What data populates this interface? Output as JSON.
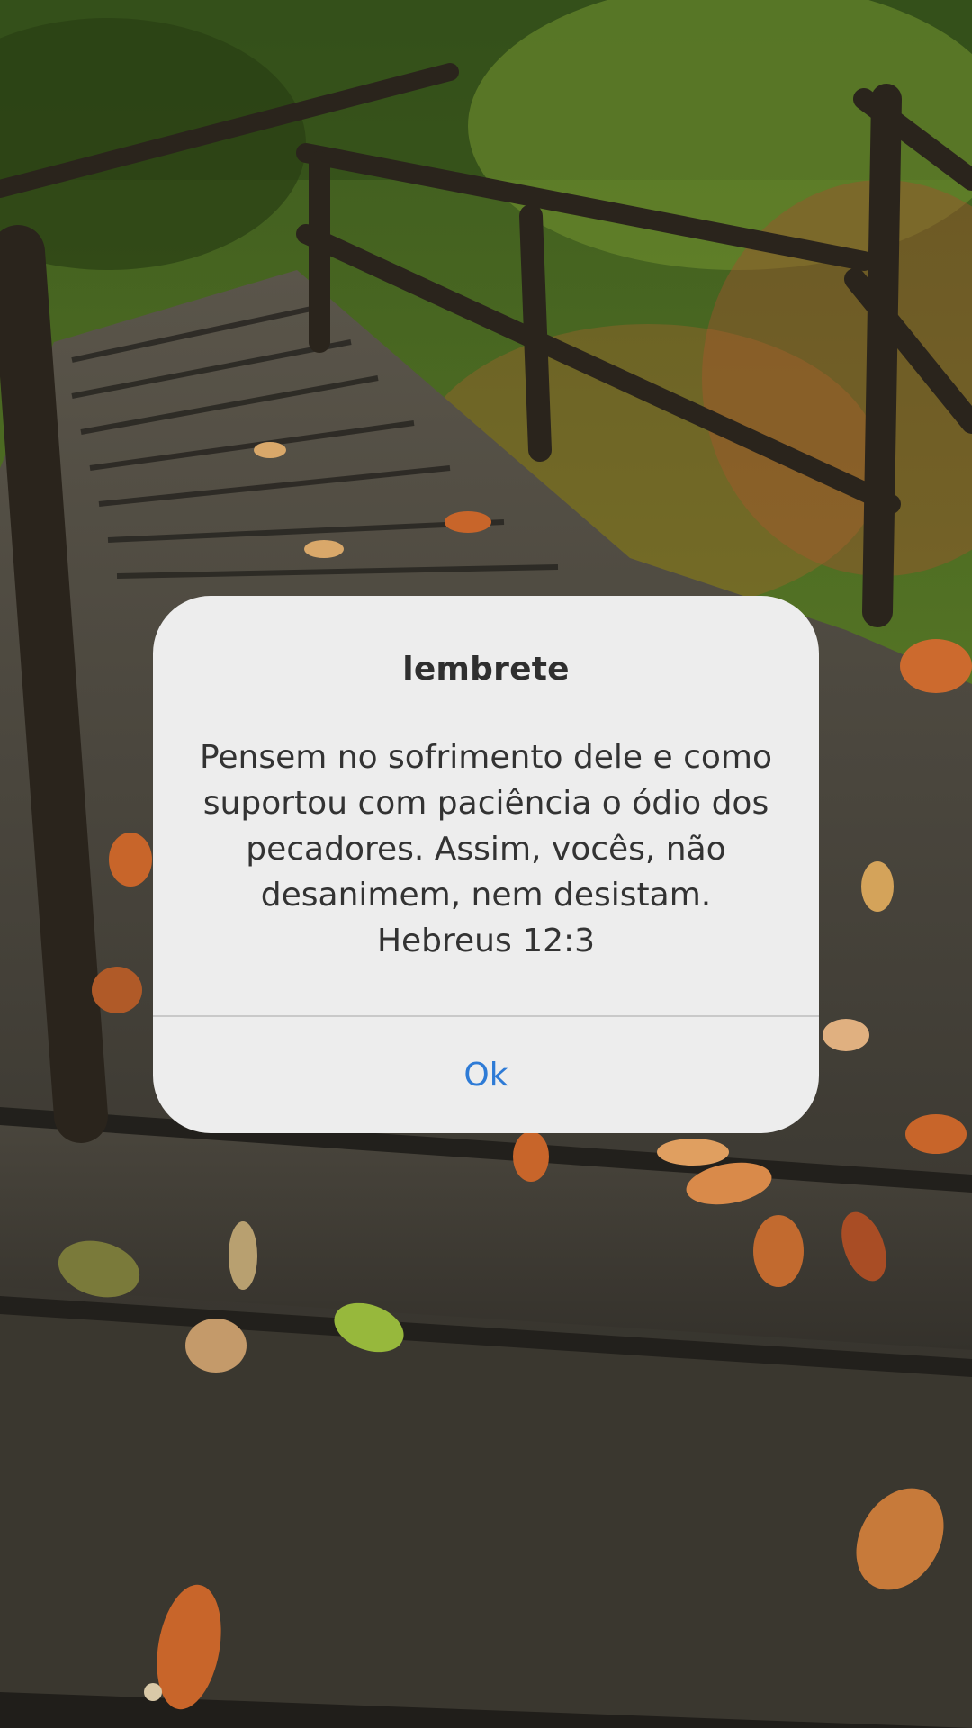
{
  "dialog": {
    "title": "lembrete",
    "message_lines": [
      "Pensem no sofrimento dele e como",
      "suportou com paciência o ódio dos",
      "pecadores. Assim, vocês, não",
      "desanimem, nem desistam.",
      "Hebreus 12:3"
    ],
    "ok_label": "Ok"
  },
  "colors": {
    "dialog_background": "#ededed",
    "title_text": "#2f2f2f",
    "message_text": "#333333",
    "ok_button_text": "#2e7bd6",
    "divider": "#c9c9c9"
  }
}
